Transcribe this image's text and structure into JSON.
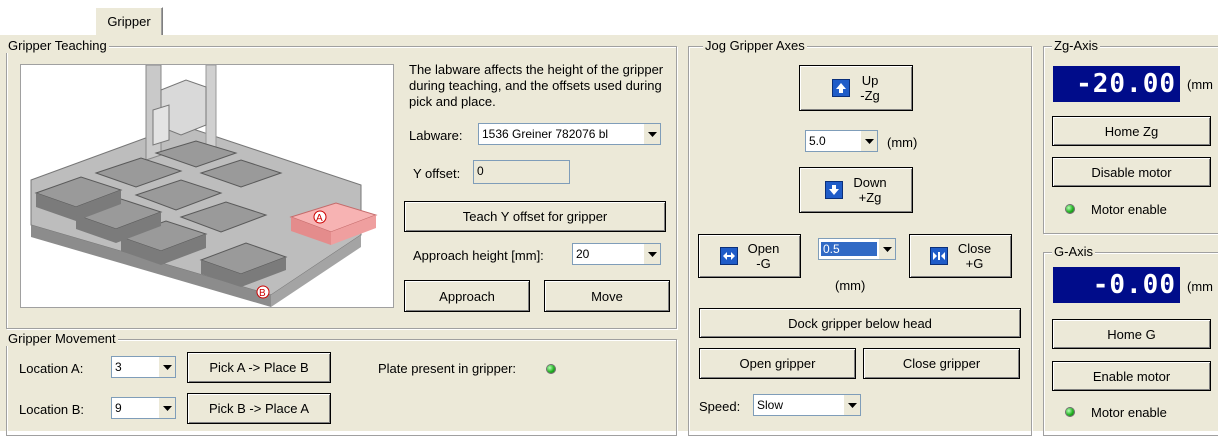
{
  "tab": {
    "label": "Gripper"
  },
  "teaching": {
    "title": "Gripper Teaching",
    "description": "The labware affects the height of the gripper during teaching, and the offsets used during pick and place.",
    "labware_label": "Labware:",
    "labware_value": "1536 Greiner 782076 bl",
    "y_offset_label": "Y offset:",
    "y_offset_value": "0",
    "teach_button": "Teach Y offset for gripper",
    "approach_height_label": "Approach height [mm]:",
    "approach_height_value": "20",
    "approach_button": "Approach",
    "move_button": "Move",
    "marker_a": "A",
    "marker_b": "B"
  },
  "movement": {
    "title": "Gripper Movement",
    "location_a_label": "Location A:",
    "location_a_value": "3",
    "location_b_label": "Location B:",
    "location_b_value": "9",
    "pick_a_button": "Pick A -> Place B",
    "pick_b_button": "Pick B -> Place A",
    "plate_present_label": "Plate present in gripper:"
  },
  "jog": {
    "title": "Jog Gripper Axes",
    "up_line1": "Up",
    "up_line2": "-Zg",
    "step_value": "5.0",
    "step_unit": "(mm)",
    "down_line1": "Down",
    "down_line2": "+Zg",
    "open_line1": "Open",
    "open_line2": "-G",
    "g_step_value": "0.5",
    "g_step_unit": "(mm)",
    "close_line1": "Close",
    "close_line2": "+G",
    "dock_button": "Dock gripper below head",
    "open_gripper_button": "Open gripper",
    "close_gripper_button": "Close gripper",
    "speed_label": "Speed:",
    "speed_value": "Slow"
  },
  "zg_axis": {
    "title": "Zg-Axis",
    "readout": "-20.00",
    "unit": "(mm",
    "home_button": "Home Zg",
    "motor_button": "Disable motor",
    "motor_status": "Motor enable"
  },
  "g_axis": {
    "title": "G-Axis",
    "readout": "-0.00",
    "unit": "(mm",
    "home_button": "Home G",
    "motor_button": "Enable motor",
    "motor_status": "Motor enable"
  },
  "colors": {
    "panel_bg": "#ece9d8",
    "lcd_bg": "#000c8a",
    "icon_blue": "#1f5cc8",
    "led_green": "#22b322",
    "highlight_plate": "#f4a0a0"
  },
  "icons": [
    "arrow-up-icon",
    "arrow-down-icon",
    "open-arrows-icon",
    "close-arrows-icon",
    "dropdown-arrow-icon",
    "led-icon"
  ]
}
